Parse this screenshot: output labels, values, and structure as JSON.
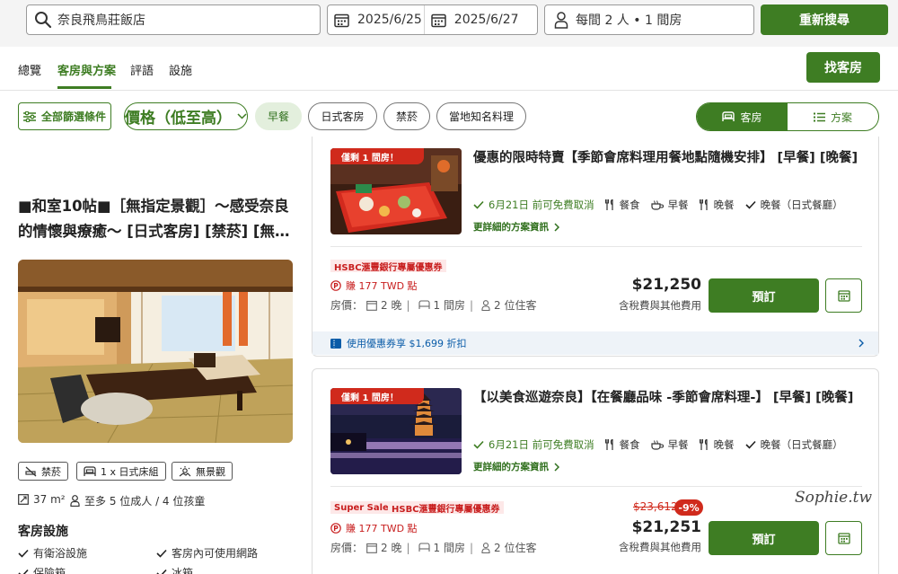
{
  "search": {
    "destination": "奈良飛鳥莊飯店",
    "checkin": "2025/6/25",
    "checkout": "2025/6/27",
    "guests": "每間 2 人 • 1 間房",
    "research_label": "重新搜尋"
  },
  "nav": {
    "tabs": [
      "總覽",
      "客房與方案",
      "評語",
      "設施"
    ],
    "find_room_label": "找客房"
  },
  "filters": {
    "all_label": "全部篩選條件",
    "price_label": "價格（低至高）",
    "chips": [
      "早餐",
      "日式客房",
      "禁菸",
      "當地知名料理"
    ],
    "toggle": [
      "客房",
      "方案"
    ]
  },
  "room": {
    "title": "■和室10帖■［無指定景觀］～感受奈良的情懷與療癒～ [日式客房] [禁菸] [無…",
    "tags": [
      "禁菸",
      "1 x 日式床組",
      "無景觀"
    ],
    "size": "37 m²",
    "capacity": "至多 5 位成人 / 4 位孩童",
    "amenities_title": "客房設施",
    "amenities": [
      "有衛浴設施",
      "客房內可使用網路",
      "保險箱",
      "冰箱"
    ]
  },
  "plans": [
    {
      "ribbon": "僅剩 1 間房！",
      "title": "優惠的限時特賣【季節會席料理用餐地點隨機安排】 [早餐] [晚餐]",
      "cancel": "6月21日 前可免費取消",
      "meals": [
        "餐食",
        "早餐",
        "晚餐"
      ],
      "dinner_place": "晚餐（日式餐廳）",
      "more": "更詳細的方案資訊",
      "badges": [
        "HSBC滙豐銀行專屬優惠券"
      ],
      "points": "賺 177 TWD 點",
      "price_prefix": "房價：",
      "nights": "2 晚",
      "rooms": "1 間房",
      "people": "2 位住客",
      "price": "$21,250",
      "tax_note": "含稅費與其他費用",
      "book_label": "預訂",
      "coupon": "使用優惠券享 $1,699 折扣"
    },
    {
      "ribbon": "僅剩 1 間房！",
      "title": "【以美食巡遊奈良】【在餐廳品味 -季節會席料理-】 [早餐] [晚餐]",
      "cancel": "6月21日 前可免費取消",
      "meals": [
        "餐食",
        "早餐",
        "晚餐"
      ],
      "dinner_place": "晚餐（日式餐廳）",
      "more": "更詳細的方案資訊",
      "badges": [
        "Super Sale",
        "HSBC滙豐銀行專屬優惠券"
      ],
      "points": "賺 177 TWD 點",
      "price_prefix": "房價：",
      "nights": "2 晚",
      "rooms": "1 間房",
      "people": "2 位住客",
      "old_price": "$23,612",
      "discount": "-9%",
      "price": "$21,251",
      "tax_note": "含稅費與其他費用",
      "book_label": "預訂"
    }
  ],
  "watermark": "Sophie.tw",
  "colors": {
    "brand_green": "#3e7d23",
    "sale_red": "#d02a1c",
    "link_blue": "#0a5ca8"
  }
}
